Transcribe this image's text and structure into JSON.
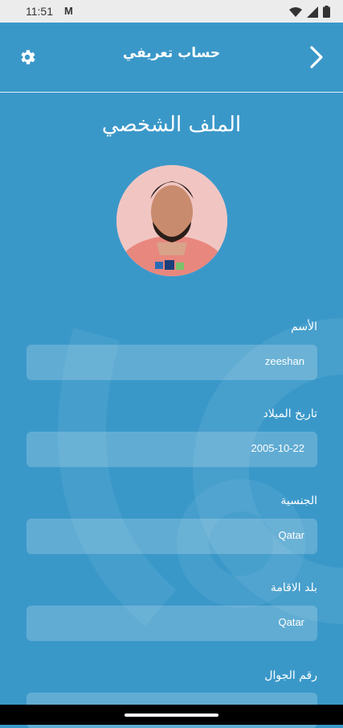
{
  "status_bar": {
    "time": "11:51",
    "app_icon": "M"
  },
  "header": {
    "title": "حساب تعريفي"
  },
  "page": {
    "title": "الملف الشخصي"
  },
  "form": {
    "name": {
      "label": "الأسم",
      "value": "zeeshan"
    },
    "birth_date": {
      "label": "تاريخ الميلاد",
      "value": "2005-10-22"
    },
    "nationality": {
      "label": "الجنسية",
      "value": "Qatar"
    },
    "residence_country": {
      "label": "بلد الاقامة",
      "value": "Qatar"
    },
    "mobile": {
      "label": "رقم الجوال",
      "value": ""
    }
  },
  "icons": {
    "settings": "gear-icon",
    "back": "chevron-right-icon",
    "wifi": "wifi-icon",
    "signal": "signal-icon",
    "battery": "battery-icon"
  },
  "colors": {
    "background": "#3A98C9",
    "field": "rgba(255,255,255,0.2)"
  }
}
